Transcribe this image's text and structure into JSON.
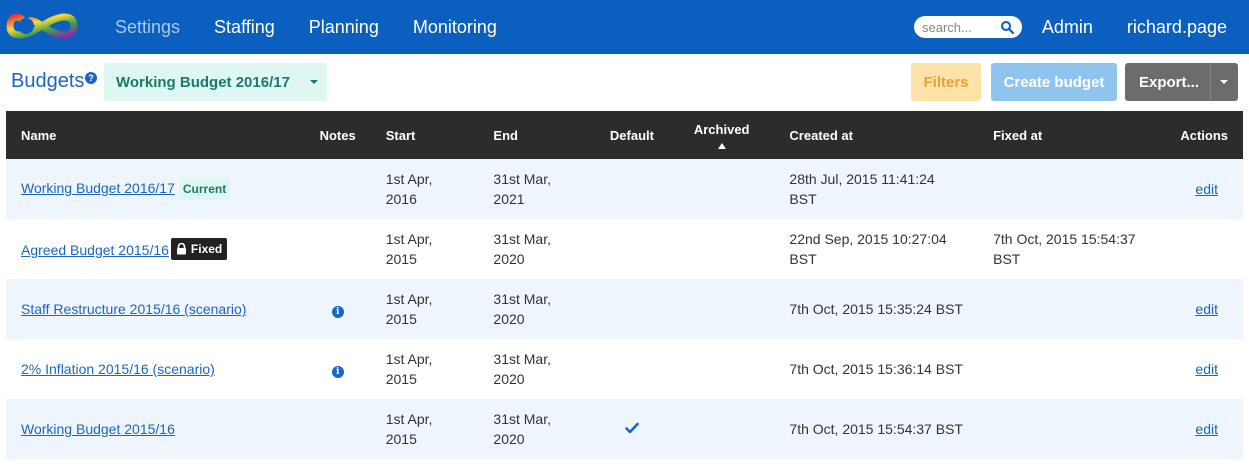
{
  "nav": {
    "links": [
      "Settings",
      "Staffing",
      "Planning",
      "Monitoring"
    ],
    "active": "Settings",
    "search_placeholder": "search...",
    "admin": "Admin",
    "user": "richard.page"
  },
  "toolbar": {
    "title": "Budgets",
    "selected_budget": "Working Budget 2016/17",
    "filters_label": "Filters",
    "create_label": "Create budget",
    "export_label": "Export..."
  },
  "table": {
    "headers": {
      "name": "Name",
      "notes": "Notes",
      "start": "Start",
      "end": "End",
      "default": "Default",
      "archived": "Archived",
      "created": "Created at",
      "fixed": "Fixed at",
      "actions": "Actions"
    },
    "rows": [
      {
        "name": "Working Budget 2016/17",
        "badge_current": "Current",
        "badge_fixed": "",
        "notes": false,
        "start": "1st Apr, 2016",
        "end": "31st Mar, 2021",
        "default": false,
        "created": "28th Jul, 2015 11:41:24 BST",
        "fixed": "",
        "action": "edit"
      },
      {
        "name": "Agreed Budget 2015/16",
        "badge_current": "",
        "badge_fixed": "Fixed",
        "notes": false,
        "start": "1st Apr, 2015",
        "end": "31st Mar, 2020",
        "default": false,
        "created": "22nd Sep, 2015 10:27:04 BST",
        "fixed": "7th Oct, 2015 15:54:37 BST",
        "action": ""
      },
      {
        "name": "Staff Restructure 2015/16 (scenario)",
        "badge_current": "",
        "badge_fixed": "",
        "notes": true,
        "start": "1st Apr, 2015",
        "end": "31st Mar, 2020",
        "default": false,
        "created": "7th Oct, 2015 15:35:24 BST",
        "fixed": "",
        "action": "edit"
      },
      {
        "name": "2% Inflation 2015/16 (scenario)",
        "badge_current": "",
        "badge_fixed": "",
        "notes": true,
        "start": "1st Apr, 2015",
        "end": "31st Mar, 2020",
        "default": false,
        "created": "7th Oct, 2015 15:36:14 BST",
        "fixed": "",
        "action": "edit"
      },
      {
        "name": "Working Budget 2015/16",
        "badge_current": "",
        "badge_fixed": "",
        "notes": false,
        "start": "1st Apr, 2015",
        "end": "31st Mar, 2020",
        "default": true,
        "created": "7th Oct, 2015 15:54:37 BST",
        "fixed": "",
        "action": "edit"
      }
    ]
  },
  "colors": {
    "navbar": "#0b5fbf",
    "accent": "#1a66c2",
    "header_bg": "#2c2c2c",
    "stripe": "#eef5fc"
  },
  "icons": {
    "logo": "infinity-logo-icon",
    "search": "search-icon",
    "help": "help-icon",
    "notes": "info-icon",
    "fixed": "lock-icon",
    "default": "checkmark-icon",
    "sort": "sort-ascending-icon"
  }
}
